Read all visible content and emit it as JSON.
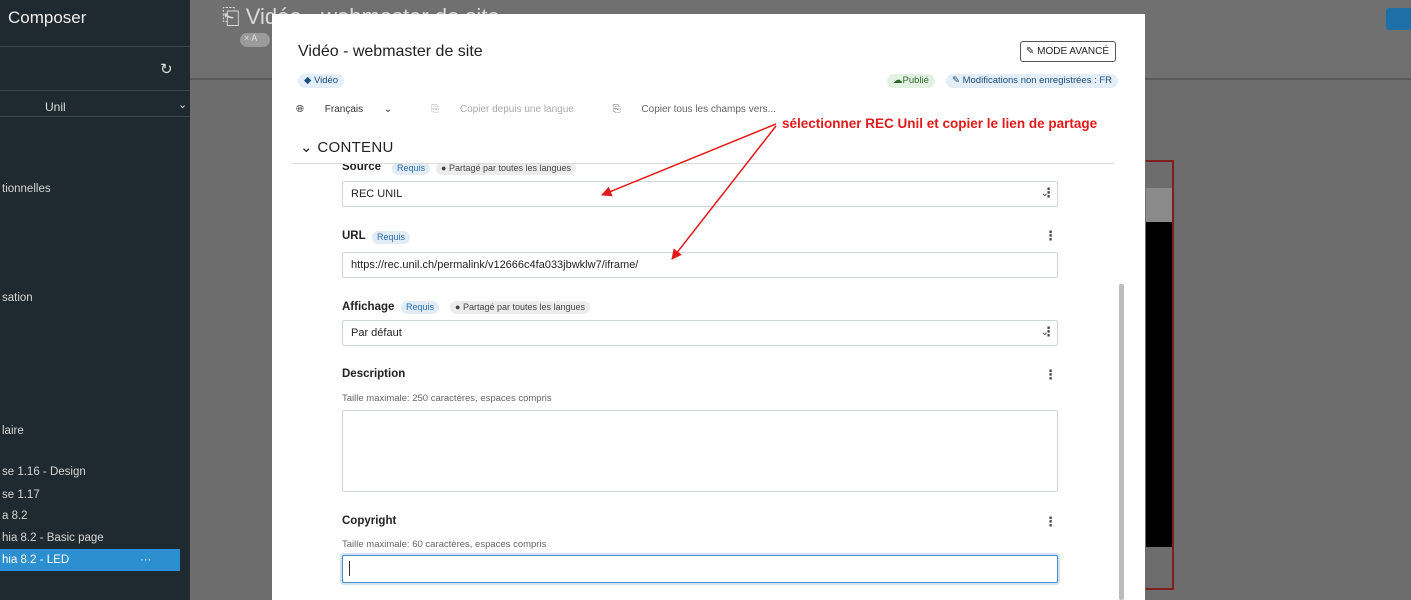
{
  "sidebar": {
    "app_title": "Composer",
    "refresh_icon": "refresh-icon",
    "site": "Unil",
    "items": [
      {
        "label": "tionnelles"
      },
      {
        "label": "sation"
      },
      {
        "label": "laire"
      },
      {
        "label": "se 1.16 - Design"
      },
      {
        "label": "se 1.17"
      },
      {
        "label": "a 8.2"
      },
      {
        "label": "hia 8.2 - Basic page"
      },
      {
        "label": "hia 8.2 - LED",
        "active": true
      }
    ],
    "more_label": "···"
  },
  "background": {
    "page_title": "Vidéo - webmaster de site",
    "chip": "× A"
  },
  "modal": {
    "title": "Vidéo - webmaster de site",
    "mode_button": "MODE AVANCÉ",
    "type_badge": "Vidéo",
    "status_published": "Publié",
    "status_modified": "Modifications non enregistrées : FR",
    "toolbar": {
      "language": "Français",
      "copy_from": "Copier depuis une langue",
      "copy_all": "Copier tous les champs vers..."
    },
    "section": "CONTENU",
    "fields": {
      "source": {
        "label": "Source",
        "required": "Requis",
        "shared": "Partagé par toutes les langues",
        "value": "REC UNIL"
      },
      "url": {
        "label": "URL",
        "required": "Requis",
        "value": "https://rec.unil.ch/permalink/v12666c4fa033jbwklw7/iframe/"
      },
      "display": {
        "label": "Affichage",
        "required": "Requis",
        "shared": "Partagé par toutes les langues",
        "value": "Par défaut"
      },
      "description": {
        "label": "Description",
        "hint": "Taille maximale: 250 caractères, espaces compris",
        "value": ""
      },
      "copyright": {
        "label": "Copyright",
        "hint": "Taille maximale: 60 caractères, espaces compris",
        "value": ""
      }
    }
  },
  "annotation": {
    "text": "sélectionner REC Unil et copier le lien de partage",
    "color": "#e01b1b"
  },
  "colors": {
    "accent": "#2c8fd0",
    "required_badge": "#2a6db0",
    "published": "#2f6b2f"
  }
}
